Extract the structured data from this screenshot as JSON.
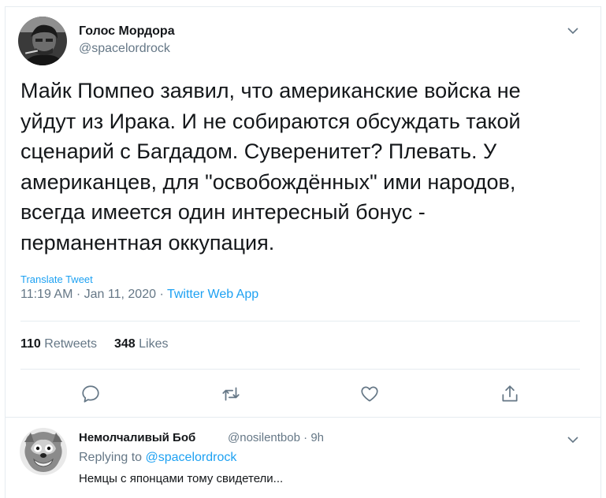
{
  "tweet": {
    "author": {
      "name": "Голос Мордора",
      "handle": "@spacelordrock"
    },
    "text_lines": [
      "Майк Помпео заявил, что американские войска не",
      "уйдут из Ирака. И не собираются обсуждать такой",
      "сценарий с Багдадом. Суверенитет? Плевать. У",
      "американцев, для \"освобождённых\" ими народов,",
      "всегда имеется один интересный бонус -",
      "перманентная оккупация."
    ],
    "translate_label": "Translate Tweet",
    "time": "11:19 AM",
    "date": "Jan 11, 2020",
    "separator": "·",
    "source": "Twitter Web App",
    "retweets_count": "110",
    "retweets_label": "Retweets",
    "likes_count": "348",
    "likes_label": "Likes",
    "actions": [
      "reply-icon",
      "retweet-icon",
      "like-icon",
      "share-icon"
    ]
  },
  "reply": {
    "author_name": "Немолчаливый Боб",
    "handle": "@nosilentbob",
    "separator": "·",
    "age": "9h",
    "replying_prefix": "Replying to",
    "replying_to": "@spacelordrock",
    "text": "Немцы с японцами тому свидетели..."
  },
  "colors": {
    "accent": "#1da1f2",
    "muted": "#657786",
    "text": "#14171a",
    "border": "#e6ecf0"
  }
}
